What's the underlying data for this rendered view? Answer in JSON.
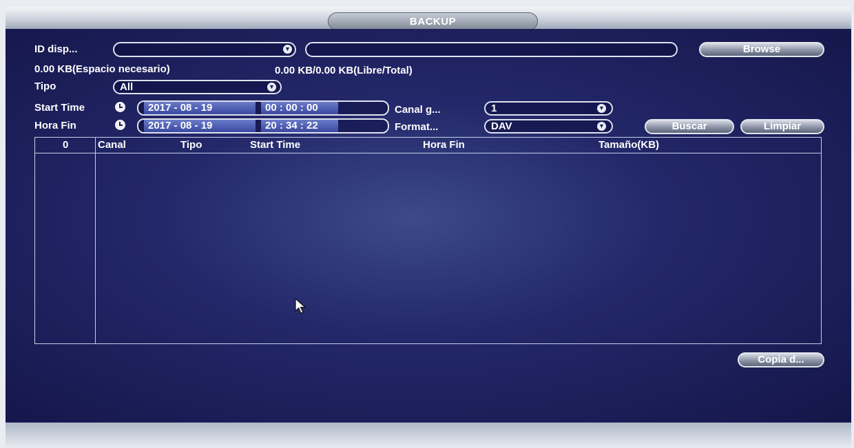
{
  "window": {
    "title": "BACKUP"
  },
  "device": {
    "id_label": "ID disp...",
    "id_value": "",
    "path_value": "",
    "browse_label": "Browse",
    "space_needed": "0.00 KB(Espacio necesario)",
    "free_total": "0.00 KB/0.00 KB(Libre/Total)"
  },
  "filter": {
    "tipo_label": "Tipo",
    "tipo_value": "All",
    "start_label": "Start Time",
    "start_date": "2017  - 08 - 19",
    "start_time": "00 : 00 : 00",
    "end_label": "Hora Fin",
    "end_date": "2017  - 08 - 19",
    "end_time": "20 : 34 : 22",
    "channel_label": "Canal g...",
    "channel_value": "1",
    "format_label": "Format...",
    "format_value": "DAV",
    "search_label": "Buscar",
    "clear_label": "Limpiar"
  },
  "table": {
    "headers": {
      "count": "0",
      "canal": "Canal",
      "tipo": "Tipo",
      "start": "Start Time",
      "end": "Hora Fin",
      "size": "Tamaño(KB)"
    },
    "rows": []
  },
  "footer": {
    "backup_label": "Copia d..."
  }
}
